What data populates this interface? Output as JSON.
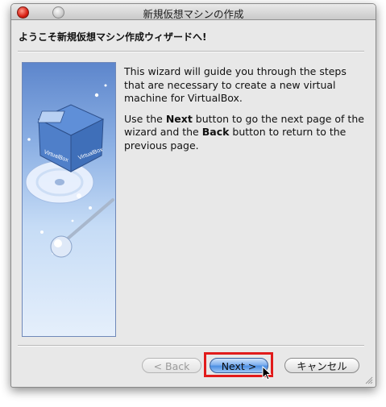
{
  "window": {
    "title": "新規仮想マシンの作成"
  },
  "wizard": {
    "heading": "ようこそ新規仮想マシン作成ウィザードへ!",
    "intro": "This wizard will guide you through the steps that are necessary to create a new virtual machine for VirtualBox.",
    "instructions": {
      "prefix": "Use the ",
      "next_word": "Next",
      "middle": " button to go the next page of the wizard and the ",
      "back_word": "Back",
      "suffix": " button to return to the previous page."
    },
    "banner_logo_text": "VirtualBox"
  },
  "buttons": {
    "back": "< Back",
    "next": "Next >",
    "cancel": "キャンセル"
  },
  "colors": {
    "highlight": "#e11b1b",
    "default_button": "#4d8fe3"
  }
}
